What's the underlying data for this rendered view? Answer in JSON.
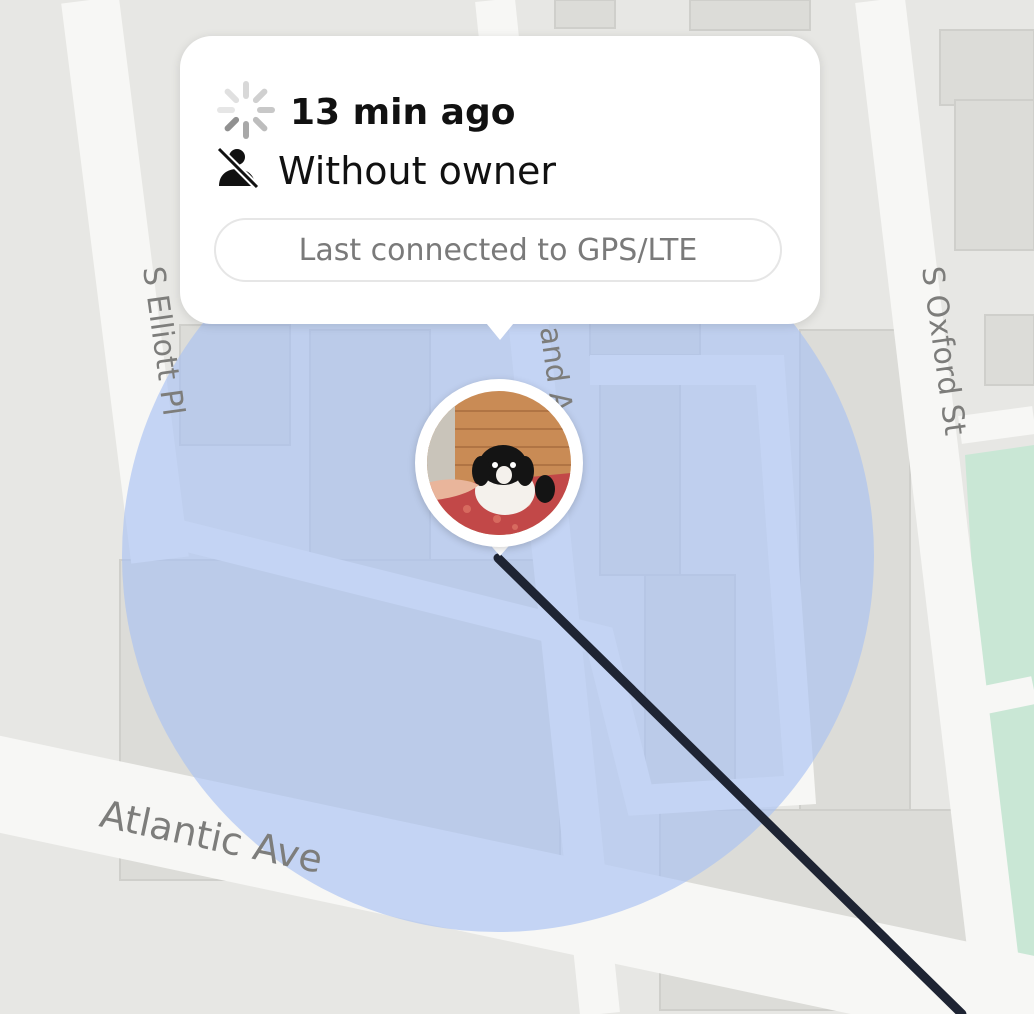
{
  "map": {
    "streets": {
      "elliott": "S Elliott Pl",
      "oxford": "S Oxford St",
      "atlantic": "Atlantic Ave",
      "partial": "and A"
    },
    "colors": {
      "land": "#e7e7e4",
      "road": "#f7f7f5",
      "building": "#dcdcd8",
      "park": "#c9e7d5",
      "accuracy_circle": "#a9c2f2",
      "track_line": "#1e2433"
    }
  },
  "popup": {
    "time_icon": "spinner-icon",
    "time": "13 min ago",
    "owner_icon": "no-person-icon",
    "owner_status": "Without owner",
    "connection": "Last connected to GPS/LTE"
  },
  "marker": {
    "avatar": "dog-photo"
  }
}
